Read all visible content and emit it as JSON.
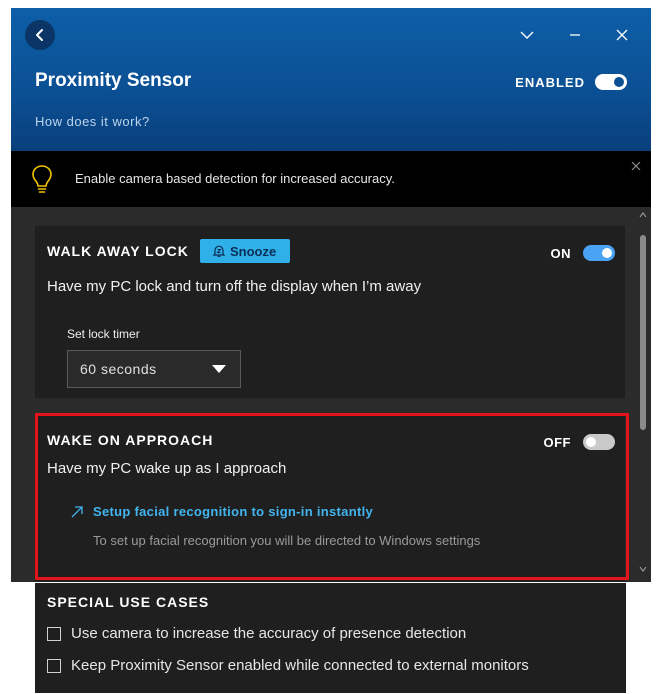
{
  "header": {
    "title": "Proximity Sensor",
    "how_link": "How does it work?",
    "enabled_label": "ENABLED",
    "enabled": true
  },
  "banner": {
    "text": "Enable camera based detection for increased accuracy.",
    "icon": "lightbulb-icon"
  },
  "walk_away": {
    "title": "WALK AWAY LOCK",
    "snooze_label": "Snooze",
    "state_label": "ON",
    "enabled": true,
    "description": "Have my PC lock and turn off the display when I’m away",
    "timer_label": "Set lock timer",
    "timer_value": "60 seconds"
  },
  "wake": {
    "title": "WAKE ON APPROACH",
    "state_label": "OFF",
    "enabled": false,
    "description": "Have my PC wake up as I approach",
    "setup_link": "Setup facial recognition to sign-in instantly",
    "setup_note": "To set up facial recognition you will be directed to Windows settings"
  },
  "special": {
    "title": "SPECIAL USE CASES",
    "options": [
      {
        "label": "Use camera to increase the accuracy of presence detection",
        "checked": false
      },
      {
        "label": "Keep Proximity Sensor enabled while connected to external monitors",
        "checked": false
      }
    ]
  },
  "colors": {
    "accent": "#42b4ee",
    "header_blue": "#0b4f93",
    "highlight_red": "#e3141b",
    "snooze_bg": "#2fb0e8"
  }
}
